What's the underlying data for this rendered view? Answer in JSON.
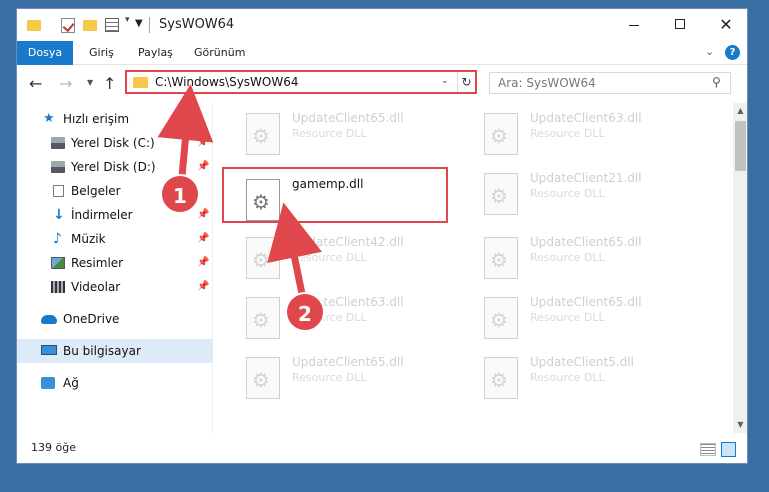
{
  "window": {
    "title": "SysWOW64"
  },
  "ribbon": {
    "tabs": [
      "Dosya",
      "Giriş",
      "Paylaş",
      "Görünüm"
    ]
  },
  "navigation": {
    "address": "C:\\Windows\\SysWOW64",
    "search_placeholder": "Ara: SysWOW64"
  },
  "sidebar": {
    "items": [
      {
        "label": "Hızlı erişim",
        "icon": "star-icon"
      },
      {
        "label": "Yerel Disk (C:)",
        "icon": "disk-icon"
      },
      {
        "label": "Yerel Disk (D:)",
        "icon": "disk-icon"
      },
      {
        "label": "Belgeler",
        "icon": "document-icon"
      },
      {
        "label": "İndirmeler",
        "icon": "download-icon"
      },
      {
        "label": "Müzik",
        "icon": "music-icon"
      },
      {
        "label": "Resimler",
        "icon": "pictures-icon"
      },
      {
        "label": "Videolar",
        "icon": "videos-icon"
      },
      {
        "label": "OneDrive",
        "icon": "cloud-icon"
      },
      {
        "label": "Bu bilgisayar",
        "icon": "computer-icon"
      },
      {
        "label": "Ağ",
        "icon": "network-icon"
      }
    ]
  },
  "files": [
    {
      "name": "UpdateClient65.dll",
      "type": "Resource DLL"
    },
    {
      "name": "UpdateClient63.dll",
      "type": "Resource DLL"
    },
    {
      "name": "gamemp.dll",
      "type": ""
    },
    {
      "name": "UpdateClient21.dll",
      "type": "Resource DLL"
    },
    {
      "name": "UpdateClient42.dll",
      "type": "Resource DLL"
    },
    {
      "name": "UpdateClient65.dll",
      "type": "Resource DLL"
    },
    {
      "name": "UpdateClient63.dll",
      "type": "Resource DLL"
    },
    {
      "name": "UpdateClient65.dll",
      "type": "Resource DLL"
    },
    {
      "name": "UpdateClient65.dll",
      "type": "Resource DLL"
    },
    {
      "name": "UpdateClient5.dll",
      "type": "Resource DLL"
    }
  ],
  "status": {
    "item_count": "139 öğe"
  },
  "annotations": {
    "step1": "1",
    "step2": "2",
    "color": "#e0474c"
  },
  "colors": {
    "accent": "#1979ca",
    "highlight": "#e0474c",
    "folder": "#f5c94a"
  }
}
